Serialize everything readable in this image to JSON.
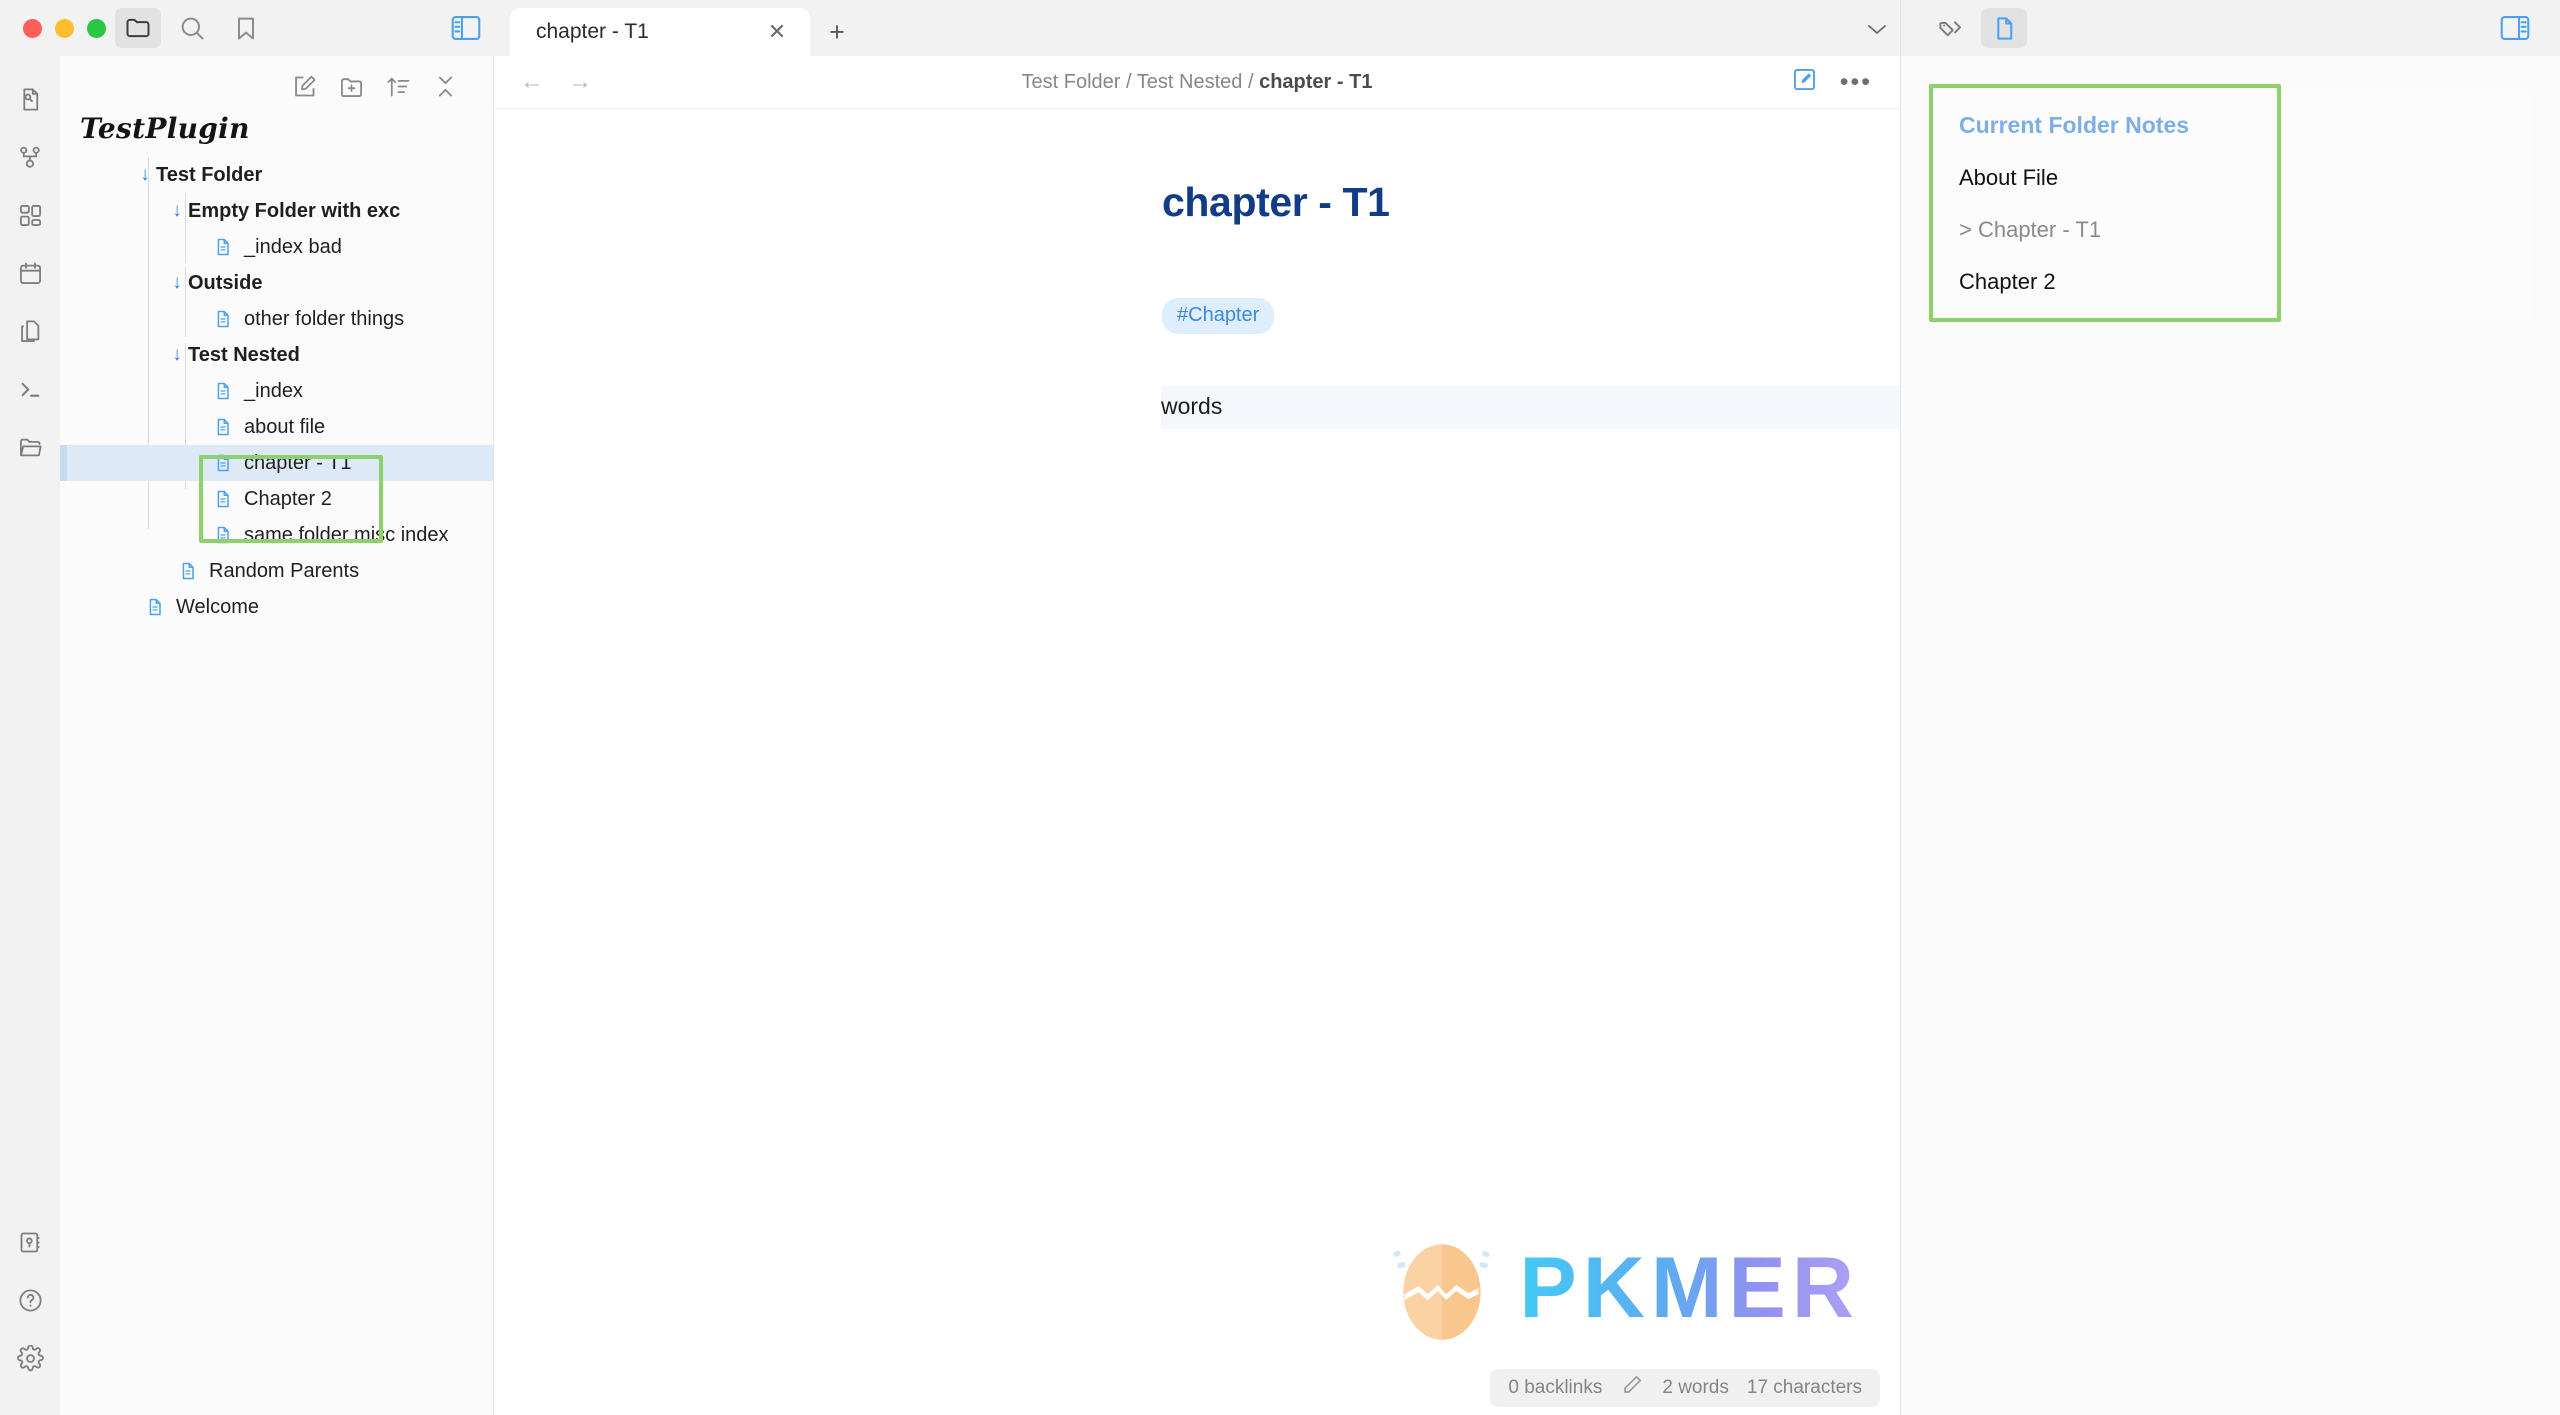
{
  "window": {
    "traffic_lights": [
      "close",
      "minimize",
      "maximize"
    ],
    "toolbar_icons": [
      "folder-icon",
      "search-icon",
      "bookmark-icon"
    ],
    "left_panel_toggle": "left-panel-toggle-icon",
    "right_panel_toggle": "right-panel-toggle-icon"
  },
  "tabs": {
    "items": [
      {
        "label": "chapter - T1",
        "close": "✕",
        "active": true
      }
    ],
    "new_tab": "+",
    "overflow": "⌄"
  },
  "right_toolbar": {
    "tags_icon": "tags-icon",
    "file_icon": "file-properties-icon"
  },
  "rail": {
    "top_items": [
      "file-search-icon",
      "graph-view-icon",
      "canvas-grid-icon",
      "calendar-icon",
      "copy-files-icon",
      "terminal-icon",
      "open-folder-icon"
    ],
    "bottom_items": [
      "vault-switcher-icon",
      "help-icon",
      "settings-icon"
    ]
  },
  "explorer": {
    "toolbar": [
      "new-note-icon",
      "new-folder-icon",
      "sort-icon",
      "collapse-all-icon"
    ],
    "vault_name": "TestPlugin",
    "tree": [
      {
        "label": "Test Folder",
        "type": "folder",
        "depth": 0,
        "arrow": "↓"
      },
      {
        "label": "Empty Folder with exc",
        "type": "folder",
        "depth": 1,
        "arrow": "↓"
      },
      {
        "label": "_index bad",
        "type": "file",
        "depth": 2
      },
      {
        "label": "Outside",
        "type": "folder",
        "depth": 1,
        "arrow": "↓"
      },
      {
        "label": "other folder things",
        "type": "file",
        "depth": 2
      },
      {
        "label": "Test Nested",
        "type": "folder",
        "depth": 1,
        "arrow": "↓"
      },
      {
        "label": "_index",
        "type": "file",
        "depth": 2
      },
      {
        "label": "about file",
        "type": "file",
        "depth": 2
      },
      {
        "label": "chapter - T1",
        "type": "file",
        "depth": 2,
        "selected": true
      },
      {
        "label": "Chapter 2",
        "type": "file",
        "depth": 2
      },
      {
        "label": "same folder misc index",
        "type": "file",
        "depth": 2
      },
      {
        "label": "Random Parents",
        "type": "file",
        "depth": 1
      },
      {
        "label": "Welcome",
        "type": "file",
        "depth": 0
      }
    ]
  },
  "editor": {
    "nav_back": "←",
    "nav_forward": "→",
    "breadcrumb": {
      "parts": [
        "Test Folder",
        "Test Nested"
      ],
      "separator": "/",
      "current": "chapter - T1"
    },
    "edit_icon": "edit-mode-icon",
    "more_menu": "•••",
    "title": "chapter - T1",
    "tag": "#Chapter",
    "body": "words"
  },
  "right_panel": {
    "card_title": "Current Folder Notes",
    "notes": [
      {
        "label": "About File",
        "dim": false
      },
      {
        "label": "> Chapter - T1",
        "dim": true
      },
      {
        "label": "Chapter 2",
        "dim": false
      }
    ]
  },
  "watermark": {
    "text": "PKMER",
    "logo": "cracked-egg-logo"
  },
  "status": {
    "backlinks": "0 backlinks",
    "edit_icon": "pencil-icon",
    "words": "2 words",
    "characters": "17 characters"
  },
  "colors": {
    "accent_blue": "#3b8ae0",
    "title_navy": "#123c86",
    "annotation_green": "#8ed06b",
    "selection_blue": "#dde9f7"
  }
}
